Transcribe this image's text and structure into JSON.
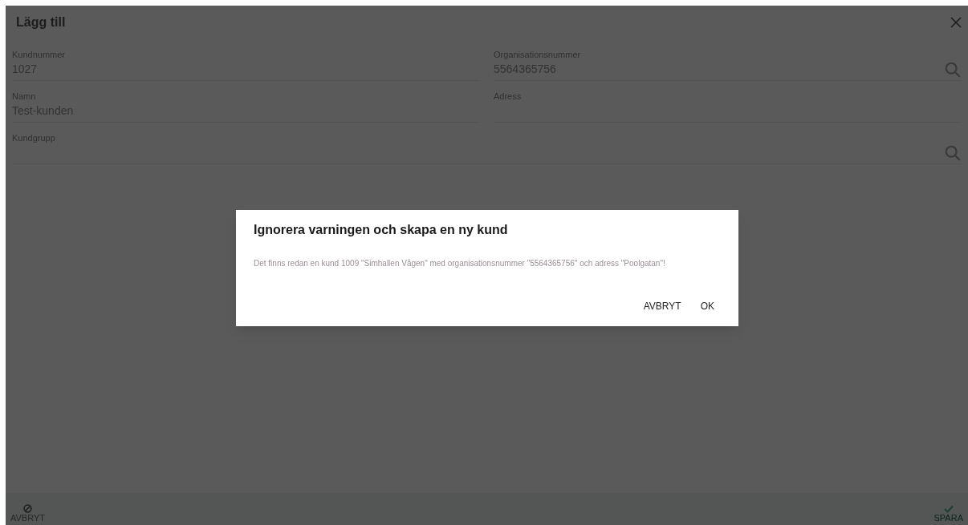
{
  "window": {
    "title": "Lägg till"
  },
  "fields": [
    {
      "label": "Kundnummer",
      "value": "1027",
      "search": false
    },
    {
      "label": "Organisationsnummer",
      "value": "5564365756",
      "search": true
    },
    {
      "label": "Namn",
      "value": "Test-kunden",
      "search": false
    },
    {
      "label": "Adress",
      "search": false
    },
    {
      "label": "Kundgrupp",
      "search": true
    }
  ],
  "dialog": {
    "title": "Ignorera varningen och skapa en ny kund",
    "message": "Det finns redan en kund 1009 \"Simhallen Vågen\" med organisationsnummer \"5564365756\" och adress \"Poolgatan\"!",
    "buttons": [
      "AVBRYT",
      "OK"
    ]
  },
  "footer": {
    "cancel": "AVBRYT",
    "save": "SPARA"
  }
}
